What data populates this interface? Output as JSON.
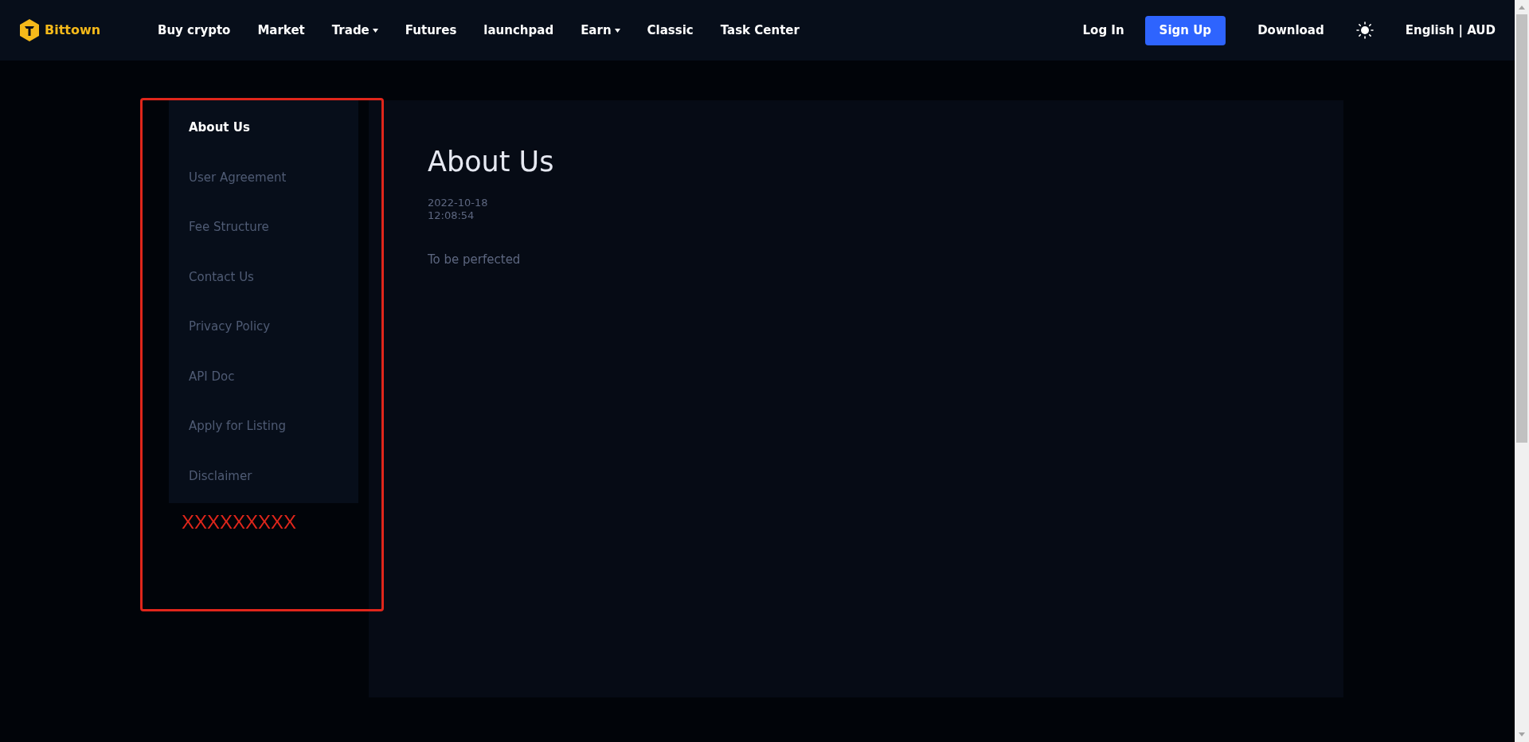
{
  "header": {
    "logo": "Bittown",
    "nav": [
      {
        "label": "Buy crypto",
        "dropdown": false
      },
      {
        "label": "Market",
        "dropdown": false
      },
      {
        "label": "Trade",
        "dropdown": true
      },
      {
        "label": "Futures",
        "dropdown": false
      },
      {
        "label": "launchpad",
        "dropdown": false
      },
      {
        "label": "Earn",
        "dropdown": true
      },
      {
        "label": "Classic",
        "dropdown": false
      },
      {
        "label": "Task Center",
        "dropdown": false
      }
    ],
    "login": "Log In",
    "signup": "Sign Up",
    "download": "Download",
    "language": "English | AUD"
  },
  "sidebar": {
    "items": [
      {
        "label": "About Us",
        "selected": true
      },
      {
        "label": "User Agreement",
        "selected": false
      },
      {
        "label": "Fee Structure",
        "selected": false
      },
      {
        "label": "Contact Us",
        "selected": false
      },
      {
        "label": "Privacy Policy",
        "selected": false
      },
      {
        "label": "API Doc",
        "selected": false
      },
      {
        "label": "Apply for Listing",
        "selected": false
      },
      {
        "label": "Disclaimer",
        "selected": false
      }
    ]
  },
  "article": {
    "title": "About Us",
    "date": "2022-10-18",
    "time": "12:08:54",
    "body": "To be perfected"
  },
  "annotation": {
    "text": "XXXXXXXXX"
  }
}
